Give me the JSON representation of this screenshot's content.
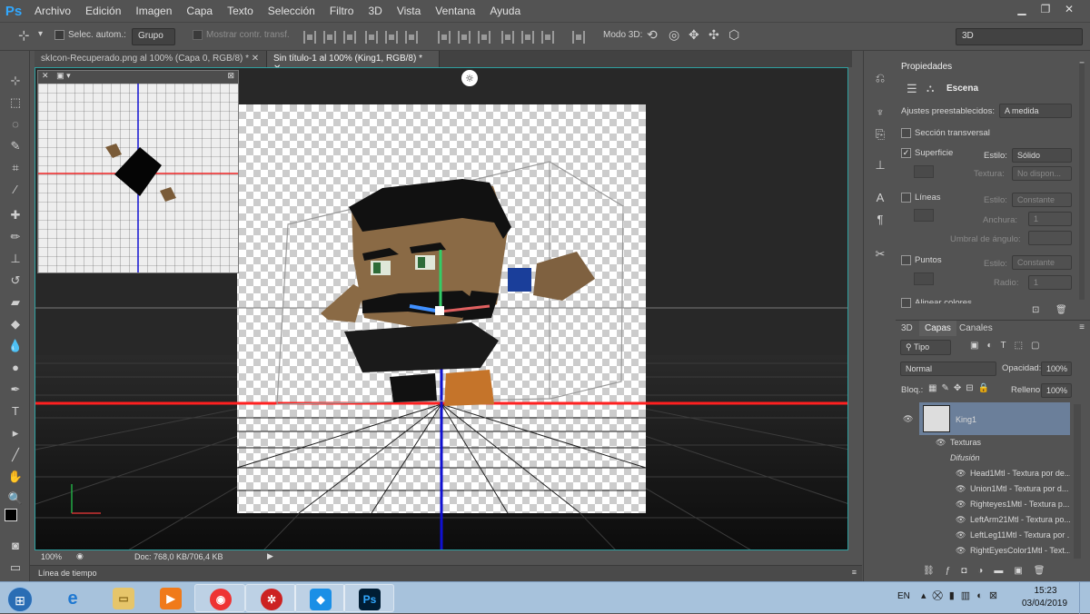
{
  "app": {
    "logo": "Ps"
  },
  "menu": [
    "Archivo",
    "Edición",
    "Imagen",
    "Capa",
    "Texto",
    "Selección",
    "Filtro",
    "3D",
    "Vista",
    "Ventana",
    "Ayuda"
  ],
  "options": {
    "auto_select_label": "Selec. autom.:",
    "group_value": "Grupo",
    "show_transform_label": "Mostrar contr. transf.",
    "mode3d_label": "Modo 3D:",
    "workspace_value": "3D"
  },
  "tabs": [
    {
      "label": "skIcon-Recuperado.png al 100% (Capa 0, RGB/8) *"
    },
    {
      "label": "Sin título-1 al 100% (King1, RGB/8) *"
    }
  ],
  "status": {
    "zoom": "100%",
    "doc": "Doc: 768,0 KB/706,4 KB"
  },
  "timeline": {
    "label": "Línea de tiempo"
  },
  "properties": {
    "title": "Propiedades",
    "tab_scene": "Escena",
    "presets_label": "Ajustes preestablecidos:",
    "presets_value": "A medida",
    "cross_section": "Sección transversal",
    "surface": "Superficie",
    "style_label": "Estilo:",
    "surface_style": "Sólido",
    "texture_label": "Textura:",
    "texture_value": "No dispon...",
    "lines": "Líneas",
    "lines_style": "Constante",
    "width_label": "Anchura:",
    "width_value": "1",
    "angle_label": "Umbral de ángulo:",
    "points": "Puntos",
    "points_style": "Constante",
    "radius_label": "Radio:",
    "radius_value": "1",
    "align_colors": "Alinear colores"
  },
  "layers": {
    "tabs": [
      "3D",
      "Capas",
      "Canales"
    ],
    "active_tab": "Capas",
    "kind_value": "Tipo",
    "blend_value": "Normal",
    "opacity_label": "Opacidad:",
    "opacity_value": "100%",
    "lock_label": "Bloq.:",
    "fill_label": "Relleno:",
    "fill_value": "100%",
    "layer_name": "King1",
    "textures_label": "Texturas",
    "diffuse_label": "Difusión",
    "items": [
      "Head1Mtl - Textura por de...",
      "Union1Mtl - Textura por d...",
      "Righteyes1Mtl - Textura p...",
      "LeftArm21Mtl - Textura po...",
      "LeftLeg11Mtl - Textura por ...",
      "RightEyesColor1Mtl - Text..."
    ]
  },
  "taskbar": {
    "lang": "EN",
    "time": "15:23",
    "date": "03/04/2019",
    "apps": [
      "start",
      "internet-explorer",
      "file-explorer",
      "media-player",
      "chrome",
      "app-red",
      "roblox",
      "photoshop"
    ]
  },
  "colors": {
    "ps_blue": "#31a8ff",
    "selection_teal": "#2ea1a1",
    "red_axis": "#ff2020",
    "blue_axis": "#1010d0"
  }
}
